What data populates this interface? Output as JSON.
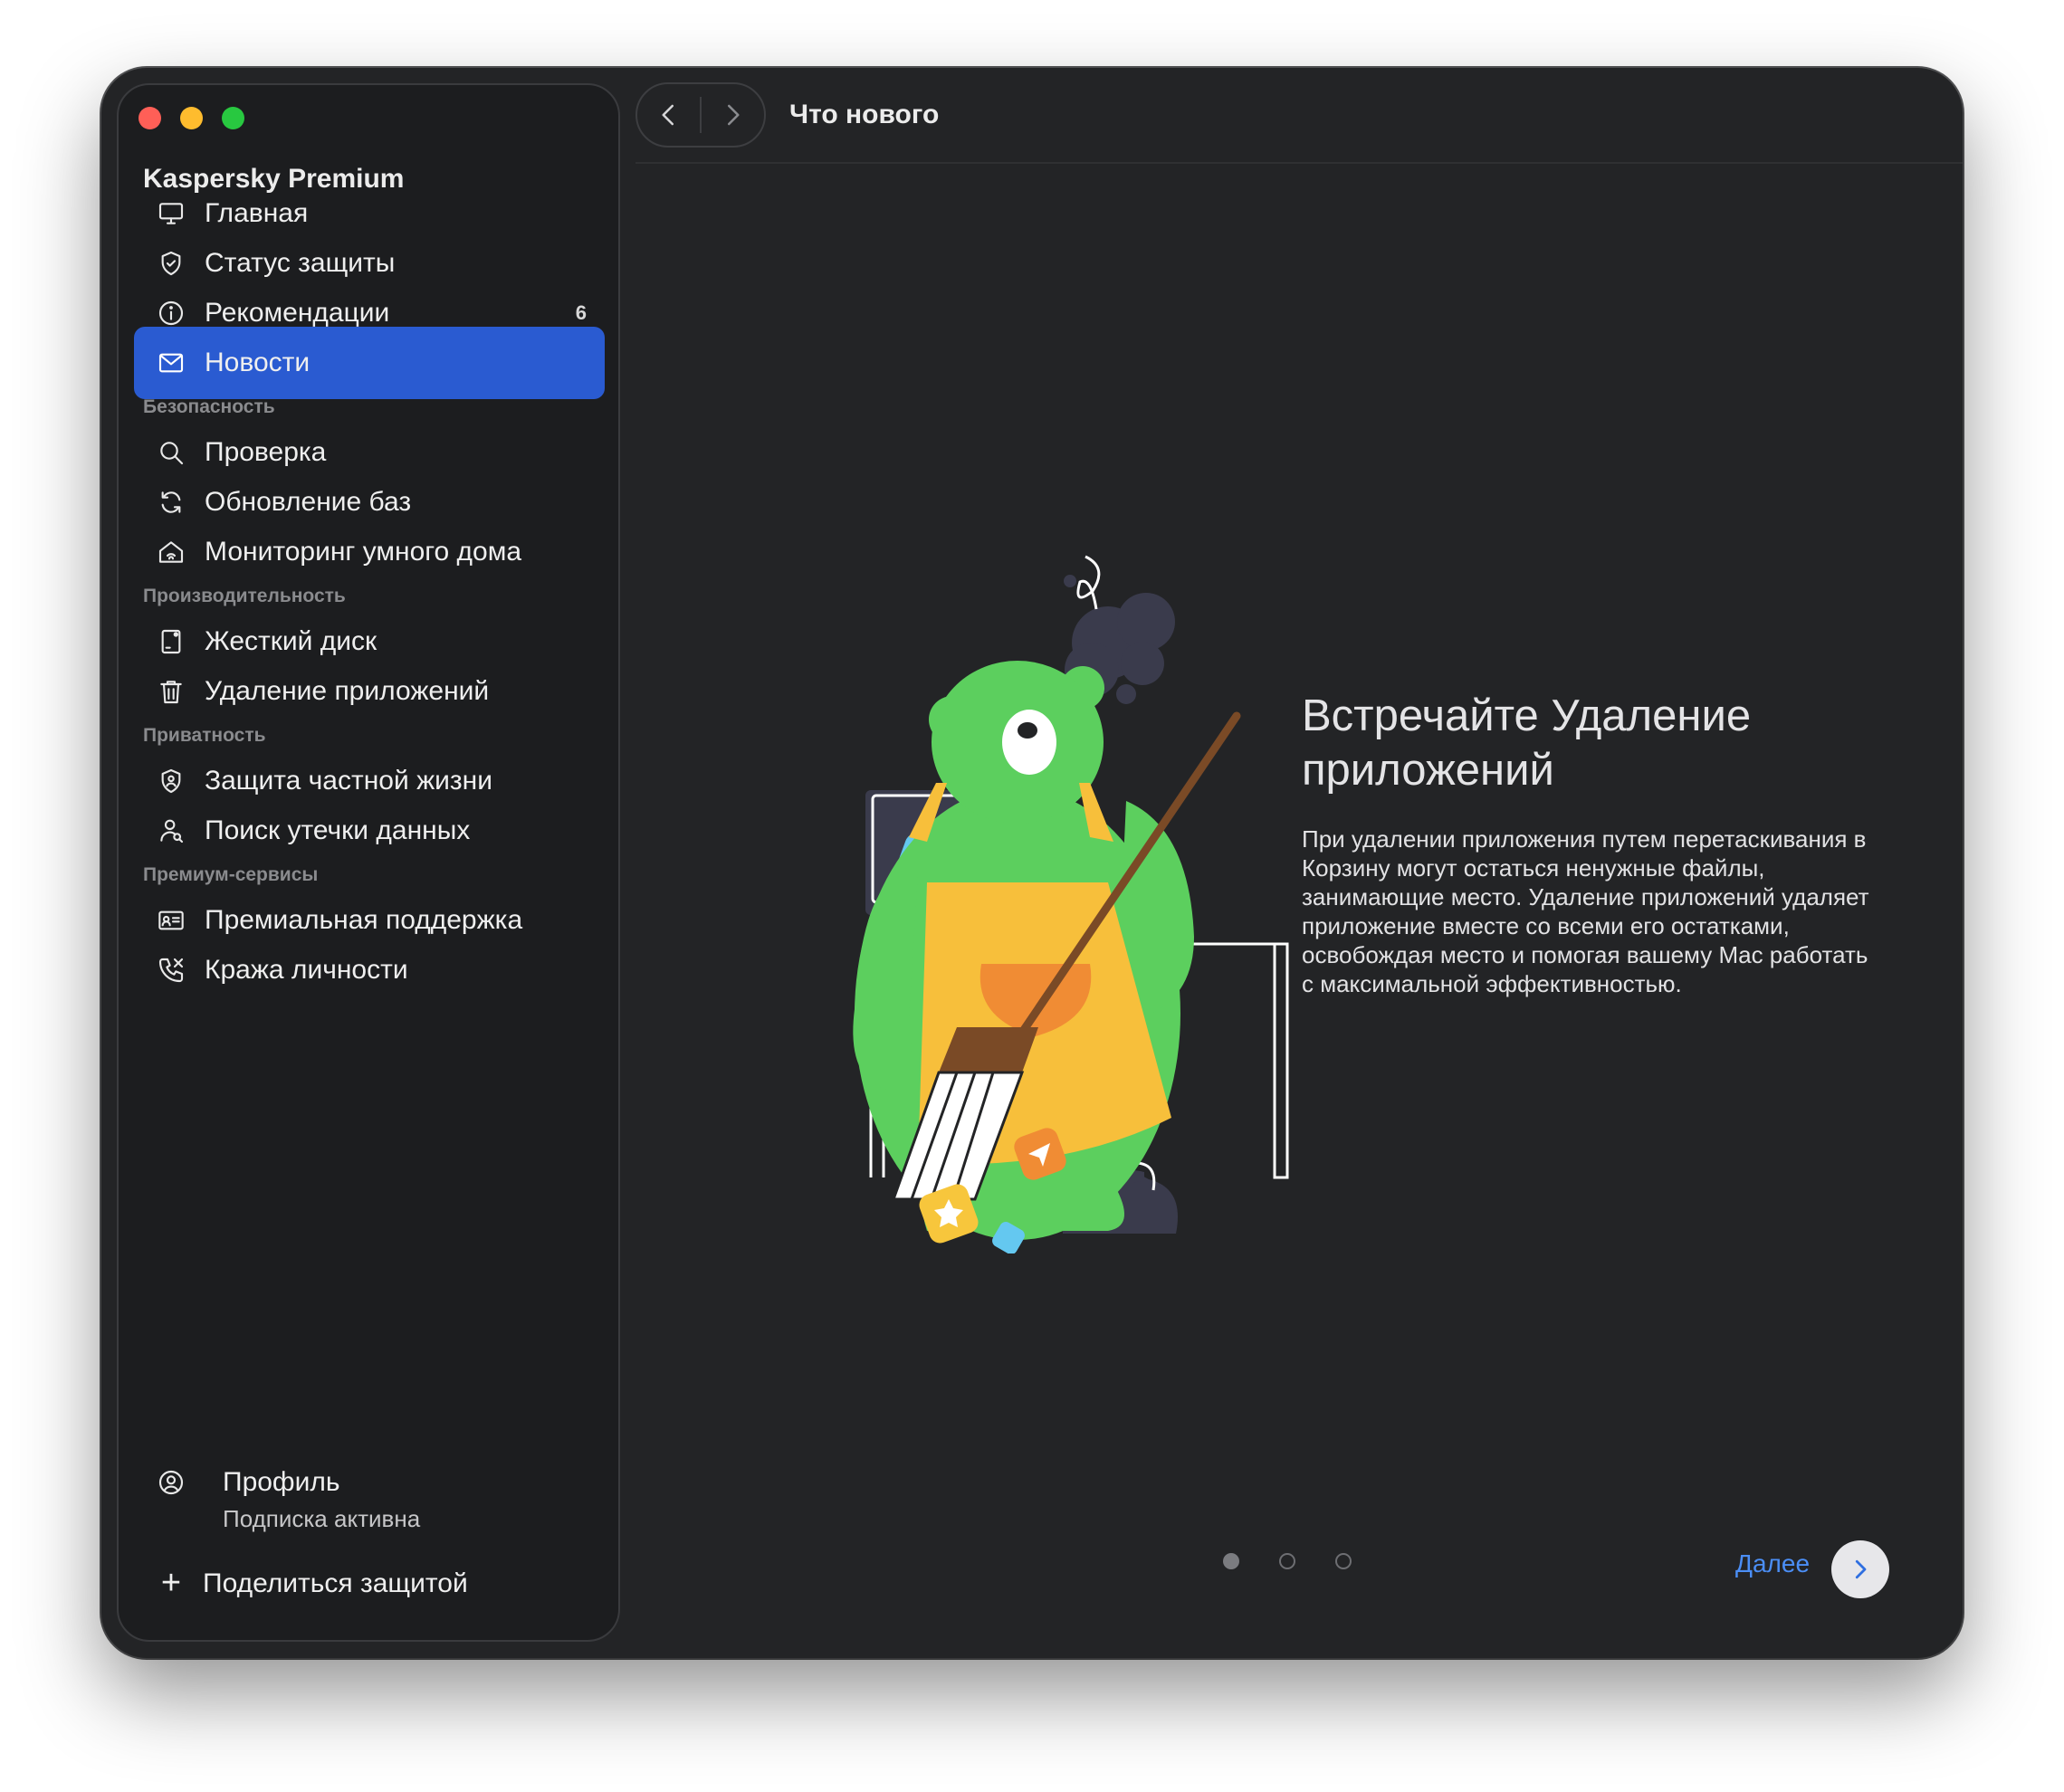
{
  "window": {
    "traffic_lights": [
      {
        "name": "close-button",
        "color": "#ff5f57"
      },
      {
        "name": "minimize-button",
        "color": "#febc2e"
      },
      {
        "name": "zoom-button",
        "color": "#28c840"
      }
    ]
  },
  "sidebar": {
    "app_title": "Kaspersky Premium",
    "main_items": [
      {
        "label": "Главная",
        "icon": "monitor-icon"
      },
      {
        "label": "Статус защиты",
        "icon": "shield-check-icon"
      },
      {
        "label": "Рекомендации",
        "icon": "info-icon",
        "badge": "6"
      },
      {
        "label": "Новости",
        "icon": "mail-icon",
        "active": true
      }
    ],
    "sections": [
      {
        "title": "Безопасность",
        "items": [
          {
            "label": "Проверка",
            "icon": "search-icon"
          },
          {
            "label": "Обновление баз",
            "icon": "refresh-icon"
          },
          {
            "label": "Мониторинг умного дома",
            "icon": "smart-home-icon"
          }
        ]
      },
      {
        "title": "Производительность",
        "items": [
          {
            "label": "Жесткий диск",
            "icon": "hard-drive-icon"
          },
          {
            "label": "Удаление приложений",
            "icon": "trash-icon"
          }
        ]
      },
      {
        "title": "Приватность",
        "items": [
          {
            "label": "Защита частной жизни",
            "icon": "privacy-shield-icon"
          },
          {
            "label": "Поиск утечки данных",
            "icon": "user-search-icon"
          }
        ]
      },
      {
        "title": "Премиум-сервисы",
        "items": [
          {
            "label": "Премиальная поддержка",
            "icon": "id-card-icon"
          },
          {
            "label": "Кража личности",
            "icon": "phone-icon"
          }
        ]
      }
    ],
    "profile": {
      "name": "Профиль",
      "status": "Подписка активна",
      "icon": "user-circle-icon"
    },
    "share": {
      "label": "Поделиться защитой",
      "icon": "plus-icon"
    },
    "active_color": "#2a5bd1"
  },
  "toolbar": {
    "title": "Что нового",
    "back_icon": "chevron-left-icon",
    "forward_icon": "chevron-right-icon"
  },
  "content": {
    "headline": "Встречайте Удаление приложений",
    "body": "При удалении приложения путем перетаскивания в Корзину могут остаться ненужные файлы, занимающие место. Удаление приложений удаляет приложение вместе со всеми его остатками, освобождая место и помогая вашему Mac работать с максимальной эффективностью.",
    "illustration": "bear-sweeping-illustration",
    "pager": {
      "total": 3,
      "current": 1
    },
    "next_label": "Далее",
    "next_icon": "chevron-right-icon",
    "link_color": "#4b8ef5"
  }
}
